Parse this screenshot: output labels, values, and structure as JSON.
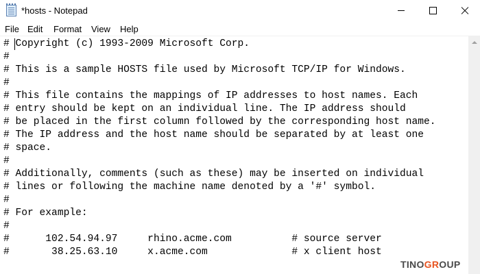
{
  "window": {
    "title": "*hosts - Notepad",
    "icon": "notepad-icon"
  },
  "menu": {
    "file": "File",
    "edit": "Edit",
    "format": "Format",
    "view": "View",
    "help": "Help"
  },
  "document": {
    "lines": [
      "# Copyright (c) 1993-2009 Microsoft Corp.",
      "#",
      "# This is a sample HOSTS file used by Microsoft TCP/IP for Windows.",
      "#",
      "# This file contains the mappings of IP addresses to host names. Each",
      "# entry should be kept on an individual line. The IP address should",
      "# be placed in the first column followed by the corresponding host name.",
      "# The IP address and the host name should be separated by at least one",
      "# space.",
      "#",
      "# Additionally, comments (such as these) may be inserted on individual",
      "# lines or following the machine name denoted by a '#' symbol.",
      "#",
      "# For example:",
      "#",
      "#      102.54.94.97     rhino.acme.com          # source server",
      "#       38.25.63.10     x.acme.com              # x client host"
    ]
  },
  "watermark": {
    "part1": "TINO",
    "accent": "GR",
    "part2": "O",
    "part3": "UP",
    "accent_color": "#e8531f"
  }
}
